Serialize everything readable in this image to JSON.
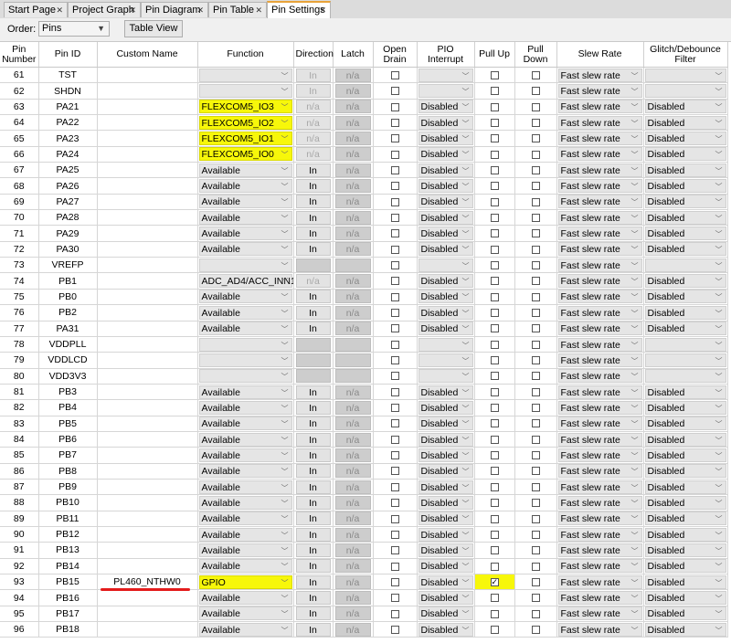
{
  "tabs": [
    {
      "label": "Start Page"
    },
    {
      "label": "Project Graph"
    },
    {
      "label": "Pin Diagram"
    },
    {
      "label": "Pin Table"
    },
    {
      "label": "Pin Settings",
      "active": true
    }
  ],
  "toolbar": {
    "order_label": "Order:",
    "order_value": "Pins",
    "table_view_label": "Table View"
  },
  "columns": [
    "Pin Number",
    "Pin ID",
    "Custom Name",
    "Function",
    "Direction",
    "Latch",
    "Open Drain",
    "PIO Interrupt",
    "Pull Up",
    "Pull Down",
    "Slew Rate",
    "Glitch/Debounce Filter"
  ],
  "colors": {
    "highlight": "#f7f70a",
    "annotation": "#e41b1b",
    "active_tab_accent": "#e8a33a"
  },
  "rows": [
    {
      "num": "61",
      "id": "TST",
      "custom": "",
      "func": "",
      "func_hl": false,
      "dir": "In",
      "dir_enabled": false,
      "latch": "n/a",
      "pio": "",
      "pu": false,
      "pu_hl": false,
      "slew": "Fast slew rate",
      "glitch": ""
    },
    {
      "num": "62",
      "id": "SHDN",
      "custom": "",
      "func": "",
      "func_hl": false,
      "dir": "In",
      "dir_enabled": false,
      "latch": "n/a",
      "pio": "",
      "pu": false,
      "pu_hl": false,
      "slew": "Fast slew rate",
      "glitch": ""
    },
    {
      "num": "63",
      "id": "PA21",
      "custom": "",
      "func": "FLEXCOM5_IO3",
      "func_hl": true,
      "dir": "n/a",
      "dir_enabled": false,
      "latch": "n/a",
      "pio": "Disabled",
      "pu": false,
      "pu_hl": false,
      "slew": "Fast slew rate",
      "glitch": "Disabled"
    },
    {
      "num": "64",
      "id": "PA22",
      "custom": "",
      "func": "FLEXCOM5_IO2",
      "func_hl": true,
      "dir": "n/a",
      "dir_enabled": false,
      "latch": "n/a",
      "pio": "Disabled",
      "pu": false,
      "pu_hl": false,
      "slew": "Fast slew rate",
      "glitch": "Disabled"
    },
    {
      "num": "65",
      "id": "PA23",
      "custom": "",
      "func": "FLEXCOM5_IO1",
      "func_hl": true,
      "dir": "n/a",
      "dir_enabled": false,
      "latch": "n/a",
      "pio": "Disabled",
      "pu": false,
      "pu_hl": false,
      "slew": "Fast slew rate",
      "glitch": "Disabled"
    },
    {
      "num": "66",
      "id": "PA24",
      "custom": "",
      "func": "FLEXCOM5_IO0",
      "func_hl": true,
      "dir": "n/a",
      "dir_enabled": false,
      "latch": "n/a",
      "pio": "Disabled",
      "pu": false,
      "pu_hl": false,
      "slew": "Fast slew rate",
      "glitch": "Disabled"
    },
    {
      "num": "67",
      "id": "PA25",
      "custom": "",
      "func": "Available",
      "func_hl": false,
      "dir": "In",
      "dir_enabled": true,
      "latch": "n/a",
      "pio": "Disabled",
      "pu": false,
      "pu_hl": false,
      "slew": "Fast slew rate",
      "glitch": "Disabled"
    },
    {
      "num": "68",
      "id": "PA26",
      "custom": "",
      "func": "Available",
      "func_hl": false,
      "dir": "In",
      "dir_enabled": true,
      "latch": "n/a",
      "pio": "Disabled",
      "pu": false,
      "pu_hl": false,
      "slew": "Fast slew rate",
      "glitch": "Disabled"
    },
    {
      "num": "69",
      "id": "PA27",
      "custom": "",
      "func": "Available",
      "func_hl": false,
      "dir": "In",
      "dir_enabled": true,
      "latch": "n/a",
      "pio": "Disabled",
      "pu": false,
      "pu_hl": false,
      "slew": "Fast slew rate",
      "glitch": "Disabled"
    },
    {
      "num": "70",
      "id": "PA28",
      "custom": "",
      "func": "Available",
      "func_hl": false,
      "dir": "In",
      "dir_enabled": true,
      "latch": "n/a",
      "pio": "Disabled",
      "pu": false,
      "pu_hl": false,
      "slew": "Fast slew rate",
      "glitch": "Disabled"
    },
    {
      "num": "71",
      "id": "PA29",
      "custom": "",
      "func": "Available",
      "func_hl": false,
      "dir": "In",
      "dir_enabled": true,
      "latch": "n/a",
      "pio": "Disabled",
      "pu": false,
      "pu_hl": false,
      "slew": "Fast slew rate",
      "glitch": "Disabled"
    },
    {
      "num": "72",
      "id": "PA30",
      "custom": "",
      "func": "Available",
      "func_hl": false,
      "dir": "In",
      "dir_enabled": true,
      "latch": "n/a",
      "pio": "Disabled",
      "pu": false,
      "pu_hl": false,
      "slew": "Fast slew rate",
      "glitch": "Disabled"
    },
    {
      "num": "73",
      "id": "VREFP",
      "custom": "",
      "func": "",
      "func_hl": false,
      "dir": "",
      "dir_enabled": false,
      "latch": "",
      "pio": "",
      "pu": false,
      "pu_hl": false,
      "slew": "Fast slew rate",
      "glitch": ""
    },
    {
      "num": "74",
      "id": "PB1",
      "custom": "",
      "func": "ADC_AD4/ACC_INN1",
      "func_hl": false,
      "dir": "n/a",
      "dir_enabled": false,
      "latch": "n/a",
      "pio": "Disabled",
      "pu": false,
      "pu_hl": false,
      "slew": "Fast slew rate",
      "glitch": "Disabled"
    },
    {
      "num": "75",
      "id": "PB0",
      "custom": "",
      "func": "Available",
      "func_hl": false,
      "dir": "In",
      "dir_enabled": true,
      "latch": "n/a",
      "pio": "Disabled",
      "pu": false,
      "pu_hl": false,
      "slew": "Fast slew rate",
      "glitch": "Disabled"
    },
    {
      "num": "76",
      "id": "PB2",
      "custom": "",
      "func": "Available",
      "func_hl": false,
      "dir": "In",
      "dir_enabled": true,
      "latch": "n/a",
      "pio": "Disabled",
      "pu": false,
      "pu_hl": false,
      "slew": "Fast slew rate",
      "glitch": "Disabled"
    },
    {
      "num": "77",
      "id": "PA31",
      "custom": "",
      "func": "Available",
      "func_hl": false,
      "dir": "In",
      "dir_enabled": true,
      "latch": "n/a",
      "pio": "Disabled",
      "pu": false,
      "pu_hl": false,
      "slew": "Fast slew rate",
      "glitch": "Disabled"
    },
    {
      "num": "78",
      "id": "VDDPLL",
      "custom": "",
      "func": "",
      "func_hl": false,
      "dir": "",
      "dir_enabled": false,
      "latch": "",
      "pio": "",
      "pu": false,
      "pu_hl": false,
      "slew": "Fast slew rate",
      "glitch": ""
    },
    {
      "num": "79",
      "id": "VDDLCD",
      "custom": "",
      "func": "",
      "func_hl": false,
      "dir": "",
      "dir_enabled": false,
      "latch": "",
      "pio": "",
      "pu": false,
      "pu_hl": false,
      "slew": "Fast slew rate",
      "glitch": ""
    },
    {
      "num": "80",
      "id": "VDD3V3",
      "custom": "",
      "func": "",
      "func_hl": false,
      "dir": "",
      "dir_enabled": false,
      "latch": "",
      "pio": "",
      "pu": false,
      "pu_hl": false,
      "slew": "Fast slew rate",
      "glitch": ""
    },
    {
      "num": "81",
      "id": "PB3",
      "custom": "",
      "func": "Available",
      "func_hl": false,
      "dir": "In",
      "dir_enabled": true,
      "latch": "n/a",
      "pio": "Disabled",
      "pu": false,
      "pu_hl": false,
      "slew": "Fast slew rate",
      "glitch": "Disabled"
    },
    {
      "num": "82",
      "id": "PB4",
      "custom": "",
      "func": "Available",
      "func_hl": false,
      "dir": "In",
      "dir_enabled": true,
      "latch": "n/a",
      "pio": "Disabled",
      "pu": false,
      "pu_hl": false,
      "slew": "Fast slew rate",
      "glitch": "Disabled"
    },
    {
      "num": "83",
      "id": "PB5",
      "custom": "",
      "func": "Available",
      "func_hl": false,
      "dir": "In",
      "dir_enabled": true,
      "latch": "n/a",
      "pio": "Disabled",
      "pu": false,
      "pu_hl": false,
      "slew": "Fast slew rate",
      "glitch": "Disabled"
    },
    {
      "num": "84",
      "id": "PB6",
      "custom": "",
      "func": "Available",
      "func_hl": false,
      "dir": "In",
      "dir_enabled": true,
      "latch": "n/a",
      "pio": "Disabled",
      "pu": false,
      "pu_hl": false,
      "slew": "Fast slew rate",
      "glitch": "Disabled"
    },
    {
      "num": "85",
      "id": "PB7",
      "custom": "",
      "func": "Available",
      "func_hl": false,
      "dir": "In",
      "dir_enabled": true,
      "latch": "n/a",
      "pio": "Disabled",
      "pu": false,
      "pu_hl": false,
      "slew": "Fast slew rate",
      "glitch": "Disabled"
    },
    {
      "num": "86",
      "id": "PB8",
      "custom": "",
      "func": "Available",
      "func_hl": false,
      "dir": "In",
      "dir_enabled": true,
      "latch": "n/a",
      "pio": "Disabled",
      "pu": false,
      "pu_hl": false,
      "slew": "Fast slew rate",
      "glitch": "Disabled"
    },
    {
      "num": "87",
      "id": "PB9",
      "custom": "",
      "func": "Available",
      "func_hl": false,
      "dir": "In",
      "dir_enabled": true,
      "latch": "n/a",
      "pio": "Disabled",
      "pu": false,
      "pu_hl": false,
      "slew": "Fast slew rate",
      "glitch": "Disabled"
    },
    {
      "num": "88",
      "id": "PB10",
      "custom": "",
      "func": "Available",
      "func_hl": false,
      "dir": "In",
      "dir_enabled": true,
      "latch": "n/a",
      "pio": "Disabled",
      "pu": false,
      "pu_hl": false,
      "slew": "Fast slew rate",
      "glitch": "Disabled"
    },
    {
      "num": "89",
      "id": "PB11",
      "custom": "",
      "func": "Available",
      "func_hl": false,
      "dir": "In",
      "dir_enabled": true,
      "latch": "n/a",
      "pio": "Disabled",
      "pu": false,
      "pu_hl": false,
      "slew": "Fast slew rate",
      "glitch": "Disabled"
    },
    {
      "num": "90",
      "id": "PB12",
      "custom": "",
      "func": "Available",
      "func_hl": false,
      "dir": "In",
      "dir_enabled": true,
      "latch": "n/a",
      "pio": "Disabled",
      "pu": false,
      "pu_hl": false,
      "slew": "Fast slew rate",
      "glitch": "Disabled"
    },
    {
      "num": "91",
      "id": "PB13",
      "custom": "",
      "func": "Available",
      "func_hl": false,
      "dir": "In",
      "dir_enabled": true,
      "latch": "n/a",
      "pio": "Disabled",
      "pu": false,
      "pu_hl": false,
      "slew": "Fast slew rate",
      "glitch": "Disabled"
    },
    {
      "num": "92",
      "id": "PB14",
      "custom": "",
      "func": "Available",
      "func_hl": false,
      "dir": "In",
      "dir_enabled": true,
      "latch": "n/a",
      "pio": "Disabled",
      "pu": false,
      "pu_hl": false,
      "slew": "Fast slew rate",
      "glitch": "Disabled"
    },
    {
      "num": "93",
      "id": "PB15",
      "custom": "PL460_NTHW0",
      "func": "GPIO",
      "func_hl": true,
      "dir": "In",
      "dir_enabled": true,
      "latch": "n/a",
      "pio": "Disabled",
      "pu": true,
      "pu_hl": true,
      "slew": "Fast slew rate",
      "glitch": "Disabled"
    },
    {
      "num": "94",
      "id": "PB16",
      "custom": "",
      "func": "Available",
      "func_hl": false,
      "dir": "In",
      "dir_enabled": true,
      "latch": "n/a",
      "pio": "Disabled",
      "pu": false,
      "pu_hl": false,
      "slew": "Fast slew rate",
      "glitch": "Disabled"
    },
    {
      "num": "95",
      "id": "PB17",
      "custom": "",
      "func": "Available",
      "func_hl": false,
      "dir": "In",
      "dir_enabled": true,
      "latch": "n/a",
      "pio": "Disabled",
      "pu": false,
      "pu_hl": false,
      "slew": "Fast slew rate",
      "glitch": "Disabled"
    },
    {
      "num": "96",
      "id": "PB18",
      "custom": "",
      "func": "Available",
      "func_hl": false,
      "dir": "In",
      "dir_enabled": true,
      "latch": "n/a",
      "pio": "Disabled",
      "pu": false,
      "pu_hl": false,
      "slew": "Fast slew rate",
      "glitch": "Disabled"
    }
  ]
}
